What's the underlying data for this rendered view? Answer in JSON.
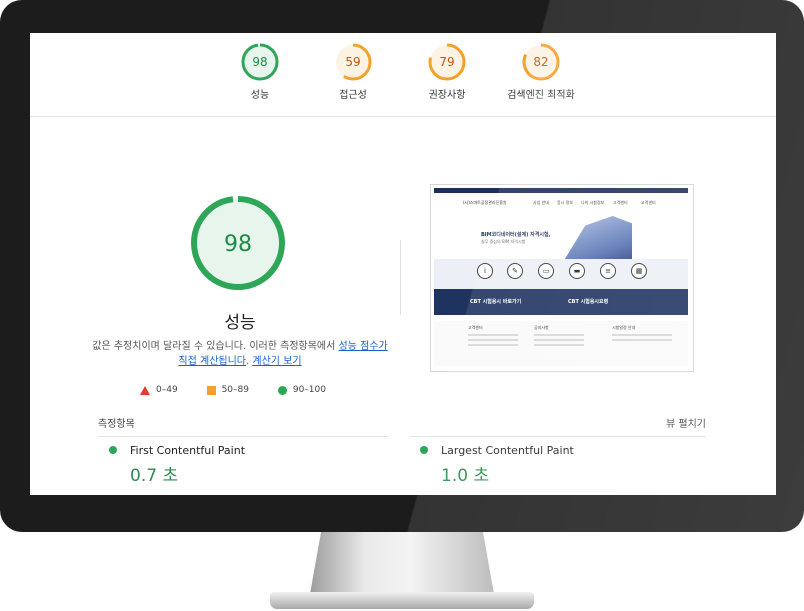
{
  "scores": [
    {
      "value": "98",
      "label": "성능",
      "pct": 0.98,
      "color": "#2ea657",
      "bg": "#e8f5ec",
      "text": "#1e8b45"
    },
    {
      "value": "59",
      "label": "접근성",
      "pct": 0.59,
      "color": "#f4a12c",
      "bg": "#fdf3e5",
      "text": "#c2570c"
    },
    {
      "value": "79",
      "label": "권장사항",
      "pct": 0.79,
      "color": "#f4a12c",
      "bg": "#fdf3e5",
      "text": "#c2570c"
    },
    {
      "value": "82",
      "label": "검색엔진 최적화",
      "pct": 0.82,
      "color": "#f4a12c",
      "bg": "#fdf3e5",
      "text": "#c2570c"
    }
  ],
  "performance": {
    "score": "98",
    "pct": 0.98,
    "title": "성능",
    "desc_plain": "값은 추정치이며 달라질 수 있습니다. 이러한 측정항목에서 ",
    "desc_link1": "성능 점수가 직접 계산됩니다",
    "desc_dot": ". ",
    "desc_link2": "계산기 보기"
  },
  "legend": {
    "fail": "0–49",
    "average": "50–89",
    "pass": "90–100"
  },
  "thumbnail": {
    "nav_brand": "(사)스마트공정관리진흥원",
    "nav_items": [
      "사업 안내",
      "응시 정보",
      "나의 시험정보",
      "고객센터",
      "고객센터"
    ],
    "hero_title": "BIM코디네이터(설계) 자격시험,",
    "hero_sub": "실무 중심의 BIM 자격시험",
    "btn_left": "CBT 시험응시 바로가기",
    "btn_right": "CBT 시험응시요령",
    "col1": "고객센터",
    "col2": "공지사항",
    "col3": "시험일정 안내"
  },
  "metrics": {
    "header": "측정항목",
    "expand": "뷰 펼치기",
    "items": [
      {
        "name": "First Contentful Paint",
        "value": "0.7 초"
      },
      {
        "name": "Largest Contentful Paint",
        "value": "1.0 초"
      }
    ]
  },
  "colors": {
    "pass": "#2ea657",
    "average": "#f4a12c",
    "fail": "#e33b30",
    "link": "#1a5fd0"
  }
}
